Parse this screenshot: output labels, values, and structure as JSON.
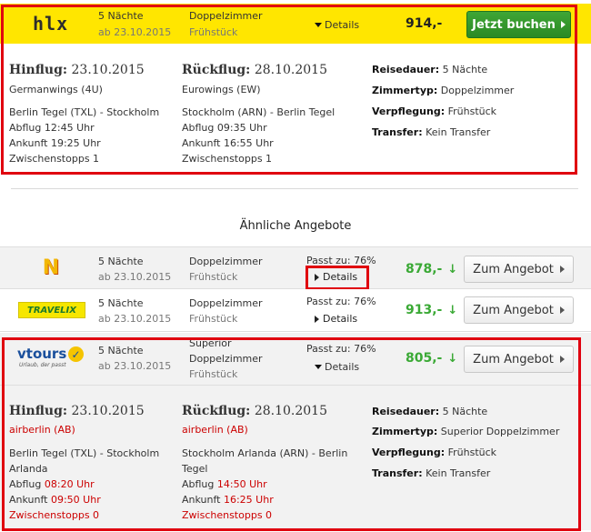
{
  "main_offer": {
    "logo_text": "hlx",
    "nights": "5 Nächte",
    "date": "ab 23.10.2015",
    "room": "Doppelzimmer",
    "board": "Frühstück",
    "details_label": "Details",
    "price": "914,-",
    "book_label": "Jetzt buchen",
    "outbound": {
      "heading_label": "Hinflug:",
      "heading_date": "23.10.2015",
      "airline": "Germanwings (4U)",
      "route": "Berlin Tegel (TXL) - Stockholm",
      "departure": "Abflug 12:45 Uhr",
      "arrival": "Ankunft 19:25 Uhr",
      "stops": "Zwischenstopps 1"
    },
    "return": {
      "heading_label": "Rückflug:",
      "heading_date": "28.10.2015",
      "airline": "Eurowings (EW)",
      "route": "Stockholm (ARN) - Berlin Tegel",
      "departure": "Abflug 09:35 Uhr",
      "arrival": "Ankunft 16:55 Uhr",
      "stops": "Zwischenstopps 1"
    },
    "summary": {
      "duration_label": "Reisedauer:",
      "duration_value": "5 Nächte",
      "room_label": "Zimmertyp:",
      "room_value": "Doppelzimmer",
      "board_label": "Verpflegung:",
      "board_value": "Frühstück",
      "transfer_label": "Transfer:",
      "transfer_value": "Kein Transfer"
    }
  },
  "similar": {
    "heading": "Ähnliche Angebote",
    "offers": [
      {
        "logo_text": "N",
        "nights": "5 Nächte",
        "date": "ab 23.10.2015",
        "room": "Doppelzimmer",
        "board": "Frühstück",
        "match": "Passt zu: 76%",
        "details_label": "Details",
        "price": "878,-",
        "trend": "↓",
        "button_label": "Zum Angebot"
      },
      {
        "logo_text": "TRAVELIX",
        "nights": "5 Nächte",
        "date": "ab 23.10.2015",
        "room": "Doppelzimmer",
        "board": "Frühstück",
        "match": "Passt zu: 76%",
        "details_label": "Details",
        "price": "913,-",
        "trend": "↓",
        "button_label": "Zum Angebot"
      },
      {
        "logo_text": "vtours",
        "logo_tagline": "Urlaub, der passt",
        "nights": "5 Nächte",
        "date": "ab 23.10.2015",
        "room_line1": "Superior",
        "room_line2": "Doppelzimmer",
        "board": "Frühstück",
        "match": "Passt zu: 76%",
        "details_label": "Details",
        "price": "805,-",
        "trend": "↓",
        "button_label": "Zum Angebot",
        "outbound": {
          "heading_label": "Hinflug:",
          "heading_date": "23.10.2015",
          "airline": "airberlin (AB)",
          "route_line1": "Berlin Tegel (TXL) - Stockholm",
          "route_line2": "Arlanda",
          "departure_label": "Abflug",
          "departure_time": "08:20 Uhr",
          "arrival_label": "Ankunft",
          "arrival_time": "09:50 Uhr",
          "stops": "Zwischenstopps 0"
        },
        "return": {
          "heading_label": "Rückflug:",
          "heading_date": "28.10.2015",
          "airline": "airberlin (AB)",
          "route_line1": "Stockholm Arlanda (ARN) - Berlin",
          "route_line2": "Tegel",
          "departure_label": "Abflug",
          "departure_time": "14:50 Uhr",
          "arrival_label": "Ankunft",
          "arrival_time": "16:25 Uhr",
          "stops": "Zwischenstopps 0"
        },
        "summary": {
          "duration_label": "Reisedauer:",
          "duration_value": "5 Nächte",
          "room_label": "Zimmertyp:",
          "room_value": "Superior Doppelzimmer",
          "board_label": "Verpflegung:",
          "board_value": "Frühstück",
          "transfer_label": "Transfer:",
          "transfer_value": "Kein Transfer"
        }
      }
    ]
  },
  "colors": {
    "highlight_yellow": "#ffe600",
    "frame_red": "#e0000f",
    "price_green": "#3aa935",
    "button_green": "#2f9428",
    "flight_red": "#cc0000"
  }
}
